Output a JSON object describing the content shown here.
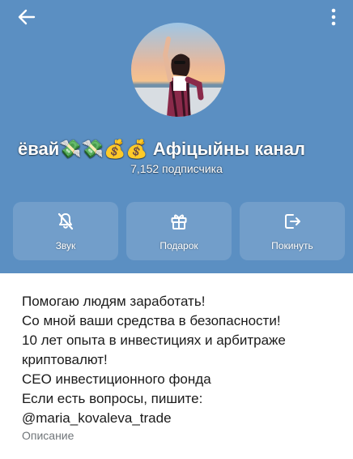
{
  "header": {
    "channel_title": "ёвай💸💸💰💰  Афіцыйны канал",
    "subscribers": "7,152 подписчика",
    "back_icon": "arrow-left-icon",
    "menu_icon": "more-vertical-icon",
    "background_color": "#5b8fc2"
  },
  "actions": [
    {
      "label": "Звук",
      "icon": "bell-muted-icon"
    },
    {
      "label": "Подарок",
      "icon": "gift-icon"
    },
    {
      "label": "Покинуть",
      "icon": "leave-icon"
    }
  ],
  "info": {
    "description_lines": [
      "Помогаю людям заработать!",
      "Со мной ваши средства в безопасности!",
      "10 лет опыта в инвестициях и арбитраже",
      "криптовалют!",
      "СЕО инвестиционного фонда",
      "Если есть вопросы, пишите:",
      "@maria_kovaleva_trade"
    ],
    "description_label": "Описание"
  }
}
